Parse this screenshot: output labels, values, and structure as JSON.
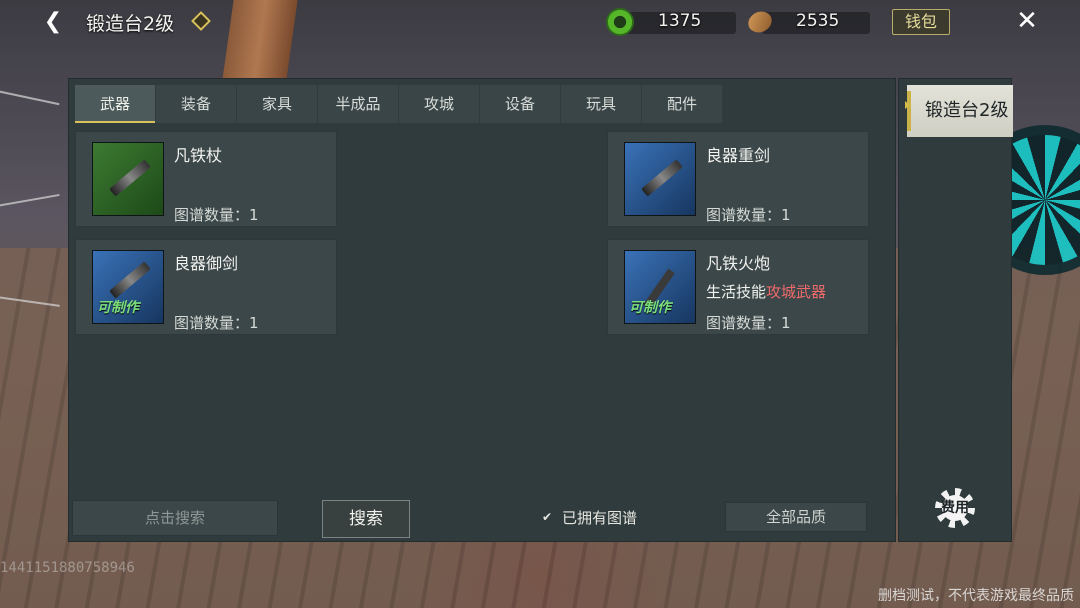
{
  "header": {
    "title": "锻造台2级",
    "currency_green": "1375",
    "currency_seed": "2535",
    "wallet_label": "钱包"
  },
  "tabs": [
    {
      "label": "武器",
      "active": true
    },
    {
      "label": "装备",
      "active": false
    },
    {
      "label": "家具",
      "active": false
    },
    {
      "label": "半成品",
      "active": false
    },
    {
      "label": "攻城",
      "active": false
    },
    {
      "label": "设备",
      "active": false
    },
    {
      "label": "玩具",
      "active": false
    },
    {
      "label": "配件",
      "active": false
    }
  ],
  "side": {
    "station_tab": "锻造台2级",
    "settings_label": "费用"
  },
  "items": [
    {
      "name": "凡铁杖",
      "count": "图谱数量：1",
      "thumb_color": "green",
      "craftable": ""
    },
    {
      "name": "良器重剑",
      "count": "图谱数量：1",
      "thumb_color": "blue",
      "craftable": ""
    },
    {
      "name": "良器御剑",
      "count": "图谱数量：1",
      "thumb_color": "blue",
      "craftable": "可制作"
    },
    {
      "name": "凡铁火炮",
      "sub_prefix": "生活技能",
      "sub_highlight": "攻城武器",
      "count": "图谱数量：1",
      "thumb_color": "blue",
      "craftable": "可制作"
    }
  ],
  "controls": {
    "search_placeholder": "点击搜索",
    "search_button": "搜索",
    "owned_label": "已拥有图谱",
    "quality_label": "全部品质"
  },
  "footer": {
    "id_watermark": "1441151880758946",
    "disclaimer": "删档测试，不代表游戏最终品质"
  },
  "colors": {
    "accent_gold": "#d9c25a",
    "highlight_red": "#ef6a6a",
    "panel_bg": "#303b3d"
  }
}
